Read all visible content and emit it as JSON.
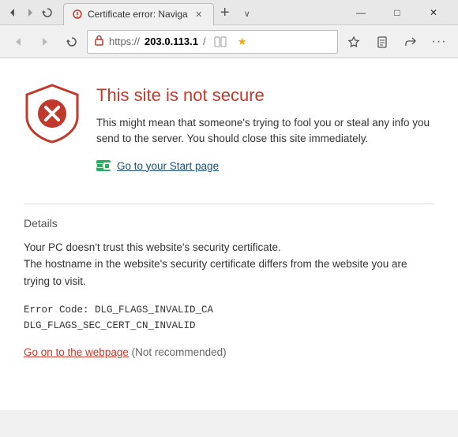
{
  "titleBar": {
    "backLabel": "←",
    "forwardLabel": "→",
    "refreshLabel": "↻",
    "minimizeLabel": "—",
    "maximizeLabel": "□",
    "closeLabel": "✕"
  },
  "tab": {
    "title": "Certificate error: Naviga",
    "closeLabel": "✕",
    "newTabLabel": "+",
    "moreLabel": "∨"
  },
  "addressBar": {
    "protocol": "https://",
    "domain": "203.0.113.1",
    "path": " /",
    "readingViewLabel": "📖",
    "favoriteLabel": "★",
    "favoritesPinLabel": "☆",
    "notesLabel": "✏",
    "shareLabel": "↗",
    "moreLabel": "···"
  },
  "page": {
    "errorTitle": "This site is not secure",
    "errorDescription": "This might mean that someone's trying to fool you or steal any info you send to the server. You should close this site immediately.",
    "goStartLabel": "Go to your Start page",
    "detailsLabel": "Details",
    "detailsText1": "Your PC doesn't trust this website's security certificate.",
    "detailsText2": "The hostname in the website's security certificate differs from the website you are trying to visit.",
    "errorCode": "Error Code:  DLG_FLAGS_INVALID_CA\nDLG_FLAGS_SEC_CERT_CN_INVALID",
    "goWebpageLabel": "Go on to the webpage",
    "notRecommended": "(Not recommended)"
  }
}
